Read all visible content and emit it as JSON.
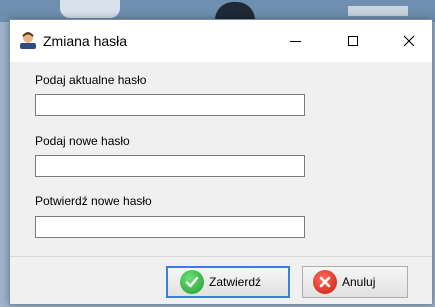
{
  "window": {
    "title": "Zmiana hasła",
    "icon": "user-avatar-icon",
    "controls": {
      "minimize": "minimize-icon",
      "maximize": "maximize-icon",
      "close": "close-icon"
    }
  },
  "form": {
    "current_password": {
      "label": "Podaj aktualne hasło",
      "value": ""
    },
    "new_password": {
      "label": "Podaj nowe hasło",
      "value": ""
    },
    "confirm_password": {
      "label": "Potwierdź nowe hasło",
      "value": ""
    }
  },
  "buttons": {
    "confirm": {
      "label": "Zatwierdź",
      "icon": "checkmark-icon",
      "color": "#1d9b2b"
    },
    "cancel": {
      "label": "Anuluj",
      "icon": "cancel-icon",
      "color": "#c81d12"
    }
  },
  "colors": {
    "focus_border": "#3c7fd6"
  }
}
